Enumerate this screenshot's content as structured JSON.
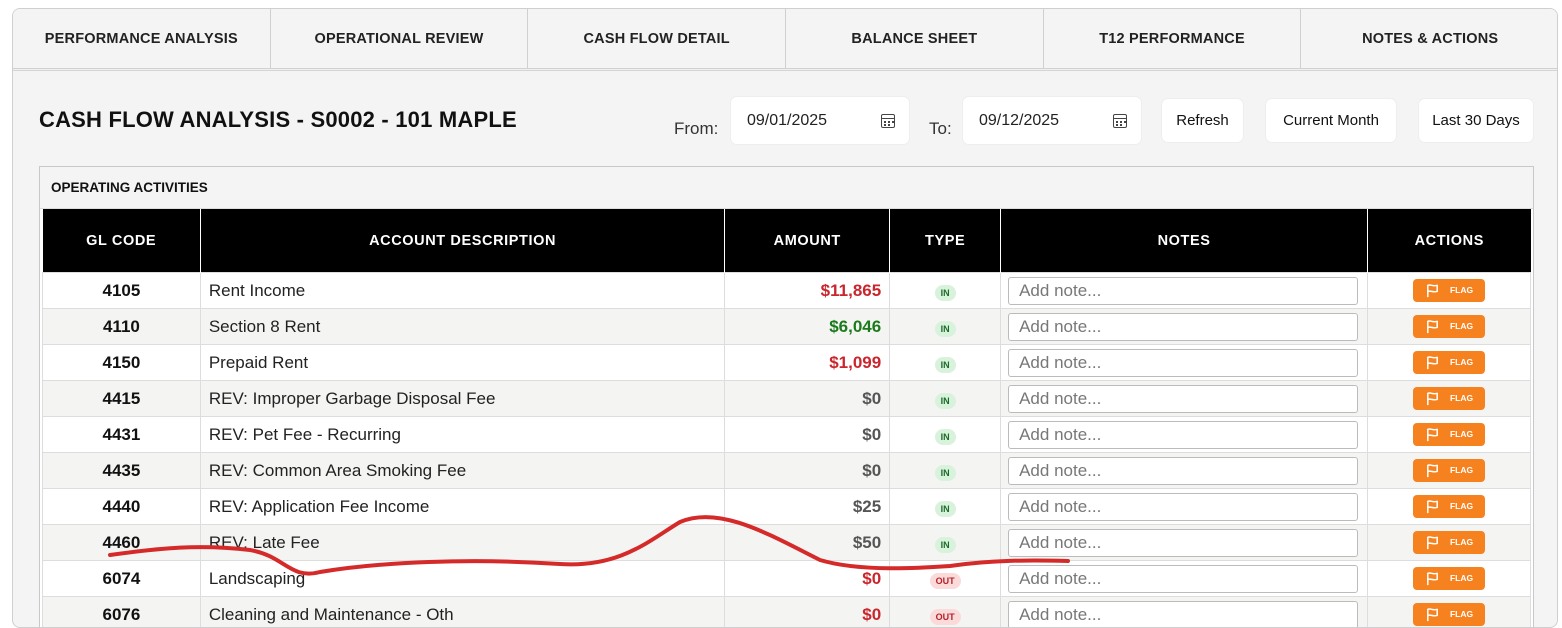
{
  "tabs": [
    "PERFORMANCE ANALYSIS",
    "OPERATIONAL REVIEW",
    "CASH FLOW DETAIL",
    "BALANCE SHEET",
    "T12 PERFORMANCE",
    "NOTES & ACTIONS"
  ],
  "header": {
    "title": "CASH FLOW ANALYSIS - S0002 - 101 MAPLE",
    "from_label": "From:",
    "from_value": "09/01/2025",
    "to_label": "To:",
    "to_value": "09/12/2025",
    "refresh": "Refresh",
    "current_month": "Current Month",
    "last_30": "Last 30 Days"
  },
  "section": {
    "title": "OPERATING ACTIVITIES",
    "columns": [
      "GL CODE",
      "ACCOUNT DESCRIPTION",
      "AMOUNT",
      "TYPE",
      "NOTES",
      "ACTIONS"
    ],
    "note_placeholder": "Add note...",
    "flag_label": "FLAG",
    "rows": [
      {
        "code": "4105",
        "desc": "Rent Income",
        "amount": "$11,865",
        "color": "red",
        "type": "IN"
      },
      {
        "code": "4110",
        "desc": "Section 8 Rent",
        "amount": "$6,046",
        "color": "green",
        "type": "IN"
      },
      {
        "code": "4150",
        "desc": "Prepaid Rent",
        "amount": "$1,099",
        "color": "red",
        "type": "IN"
      },
      {
        "code": "4415",
        "desc": "REV: Improper Garbage Disposal Fee",
        "amount": "$0",
        "color": "gray",
        "type": "IN"
      },
      {
        "code": "4431",
        "desc": "REV: Pet Fee - Recurring",
        "amount": "$0",
        "color": "gray",
        "type": "IN"
      },
      {
        "code": "4435",
        "desc": "REV: Common Area Smoking Fee",
        "amount": "$0",
        "color": "gray",
        "type": "IN"
      },
      {
        "code": "4440",
        "desc": "REV: Application Fee Income",
        "amount": "$25",
        "color": "gray",
        "type": "IN"
      },
      {
        "code": "4460",
        "desc": "REV: Late Fee",
        "amount": "$50",
        "color": "gray",
        "type": "IN"
      },
      {
        "code": "6074",
        "desc": "Landscaping",
        "amount": "$0",
        "color": "red",
        "type": "OUT"
      },
      {
        "code": "6076",
        "desc": "Cleaning and Maintenance - Oth",
        "amount": "$0",
        "color": "red",
        "type": "OUT"
      }
    ]
  },
  "colors": {
    "flag": "#f6811f",
    "accent_red": "#c9262d",
    "accent_green": "#1b7a1b",
    "scribble": "#d42a2a"
  }
}
